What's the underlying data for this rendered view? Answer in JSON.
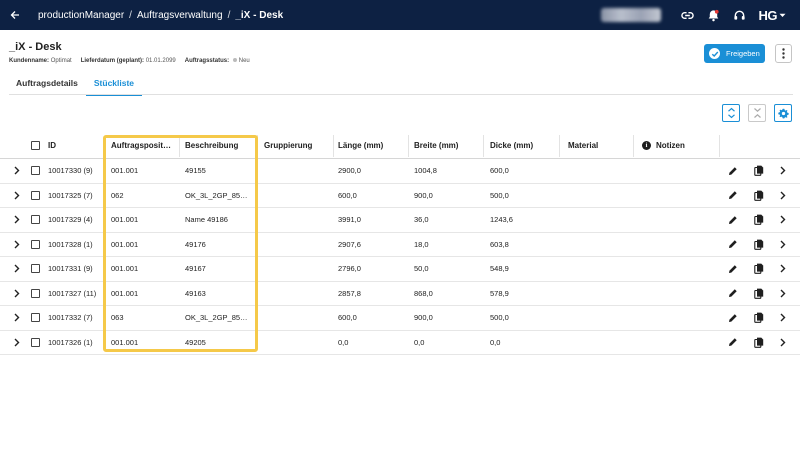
{
  "topbar": {
    "breadcrumb": [
      "productionManager",
      "Auftragsverwaltung",
      "_iX - Desk"
    ],
    "separator": "/",
    "logo": "HG"
  },
  "page": {
    "title": "_iX - Desk",
    "meta": {
      "customer_label": "Kundenname:",
      "customer_value": "Optimat",
      "delivery_label": "Lieferdatum (geplant):",
      "delivery_value": "01.01.2099",
      "status_label": "Auftragsstatus:",
      "status_value": "Neu"
    },
    "approve_label": "Freigeben"
  },
  "tabs": [
    {
      "label": "Auftragsdetails",
      "active": false
    },
    {
      "label": "Stückliste",
      "active": true
    }
  ],
  "table": {
    "headers": {
      "id": "ID",
      "position": "Auftragsposit…",
      "description": "Beschreibung",
      "grouping": "Gruppierung",
      "length": "Länge (mm)",
      "width": "Breite (mm)",
      "thickness": "Dicke (mm)",
      "material": "Material",
      "notes": "Notizen"
    },
    "rows": [
      {
        "id": "10017330 (9)",
        "position": "001.001",
        "description": "49155",
        "length": "2900,0",
        "width": "1004,8",
        "thickness": "600,0"
      },
      {
        "id": "10017325 (7)",
        "position": "062",
        "description": "OK_3L_2GP_85…",
        "length": "600,0",
        "width": "900,0",
        "thickness": "500,0"
      },
      {
        "id": "10017329 (4)",
        "position": "001.001",
        "description": "Name 49186",
        "length": "3991,0",
        "width": "36,0",
        "thickness": "1243,6"
      },
      {
        "id": "10017328 (1)",
        "position": "001.001",
        "description": "49176",
        "length": "2907,6",
        "width": "18,0",
        "thickness": "603,8"
      },
      {
        "id": "10017331 (9)",
        "position": "001.001",
        "description": "49167",
        "length": "2796,0",
        "width": "50,0",
        "thickness": "548,9"
      },
      {
        "id": "10017327 (11)",
        "position": "001.001",
        "description": "49163",
        "length": "2857,8",
        "width": "868,0",
        "thickness": "578,9"
      },
      {
        "id": "10017332 (7)",
        "position": "063",
        "description": "OK_3L_2GP_85…",
        "length": "600,0",
        "width": "900,0",
        "thickness": "500,0"
      },
      {
        "id": "10017326 (1)",
        "position": "001.001",
        "description": "49205",
        "length": "0,0",
        "width": "0,0",
        "thickness": "0,0"
      }
    ]
  },
  "colors": {
    "topbar": "#0d2143",
    "accent": "#1a8fd6",
    "highlight": "#f5c949"
  }
}
